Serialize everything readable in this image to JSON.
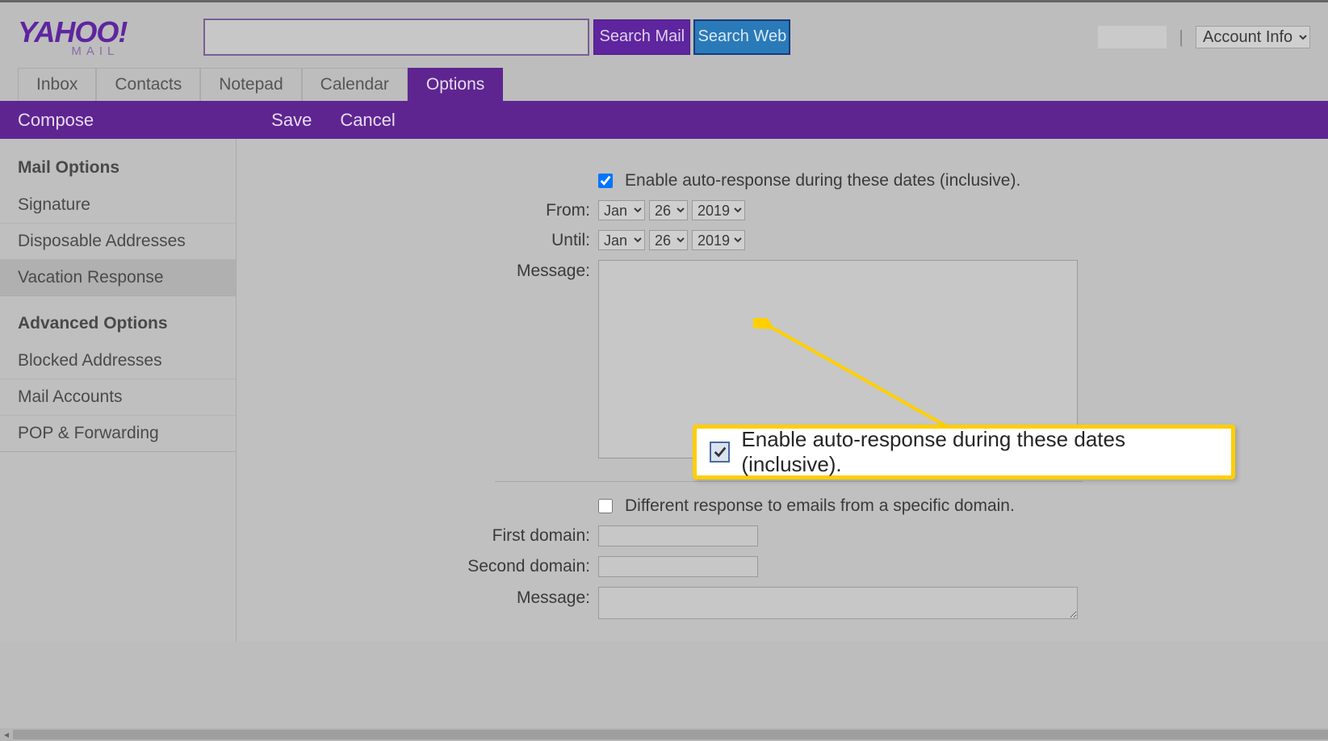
{
  "logo": {
    "brand": "YAHOO",
    "bang": "!",
    "product": "MAIL"
  },
  "search": {
    "mail_btn": "Search Mail",
    "web_btn": "Search Web"
  },
  "account": {
    "sep": "|",
    "label": "Account Info",
    "options": [
      "Account Info"
    ]
  },
  "tabs": {
    "inbox": "Inbox",
    "contacts": "Contacts",
    "notepad": "Notepad",
    "calendar": "Calendar",
    "options": "Options"
  },
  "purplebar": {
    "compose": "Compose",
    "save": "Save",
    "cancel": "Cancel"
  },
  "sidebar": {
    "mail_hdr": "Mail Options",
    "signature": "Signature",
    "disposable": "Disposable Addresses",
    "vacation": "Vacation Response",
    "adv_hdr": "Advanced Options",
    "blocked": "Blocked Addresses",
    "accounts": "Mail Accounts",
    "pop": "POP & Forwarding"
  },
  "form": {
    "enable_label": "Enable auto-response during these dates (inclusive).",
    "from_label": "From:",
    "until_label": "Until:",
    "message_label": "Message:",
    "diff_label": "Different response to emails from a specific domain.",
    "first_domain_label": "First domain:",
    "second_domain_label": "Second domain:",
    "message2_label": "Message:",
    "from": {
      "month": "Jan",
      "day": "26",
      "year": "2019"
    },
    "until": {
      "month": "Jan",
      "day": "26",
      "year": "2019"
    },
    "months": [
      "Jan"
    ],
    "days": [
      "26"
    ],
    "years": [
      "2019"
    ],
    "enable_checked": true,
    "diff_checked": false
  },
  "callout": {
    "text": "Enable auto-response during these dates (inclusive)."
  },
  "colors": {
    "purple": "#5e2590",
    "highlight": "#ffcf00",
    "blue": "#2a7ab9"
  }
}
